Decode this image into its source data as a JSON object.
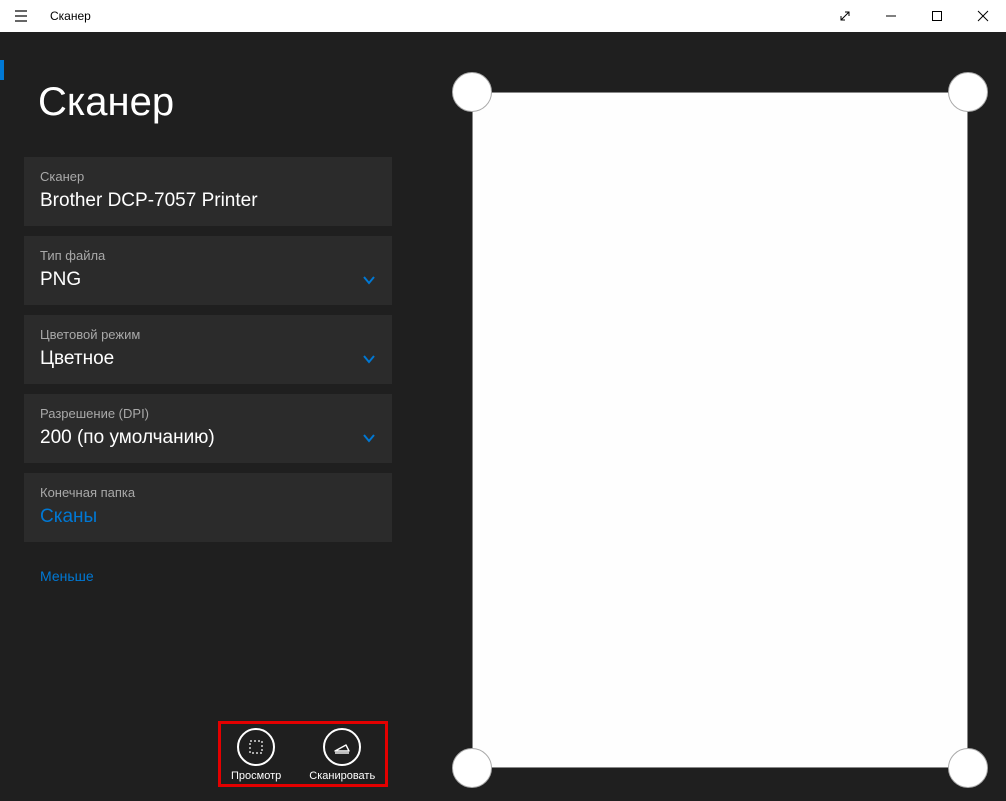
{
  "titlebar": {
    "app_name": "Сканер"
  },
  "page": {
    "title": "Сканер"
  },
  "settings": {
    "scanner_label": "Сканер",
    "scanner_value": "Brother DCP-7057 Printer",
    "filetype_label": "Тип файла",
    "filetype_value": "PNG",
    "colormode_label": "Цветовой режим",
    "colormode_value": "Цветное",
    "dpi_label": "Разрешение (DPI)",
    "dpi_value": "200 (по умолчанию)",
    "dest_label": "Конечная папка",
    "dest_value": "Сканы",
    "less_link": "Меньше"
  },
  "actions": {
    "preview_label": "Просмотр",
    "scan_label": "Сканировать"
  }
}
